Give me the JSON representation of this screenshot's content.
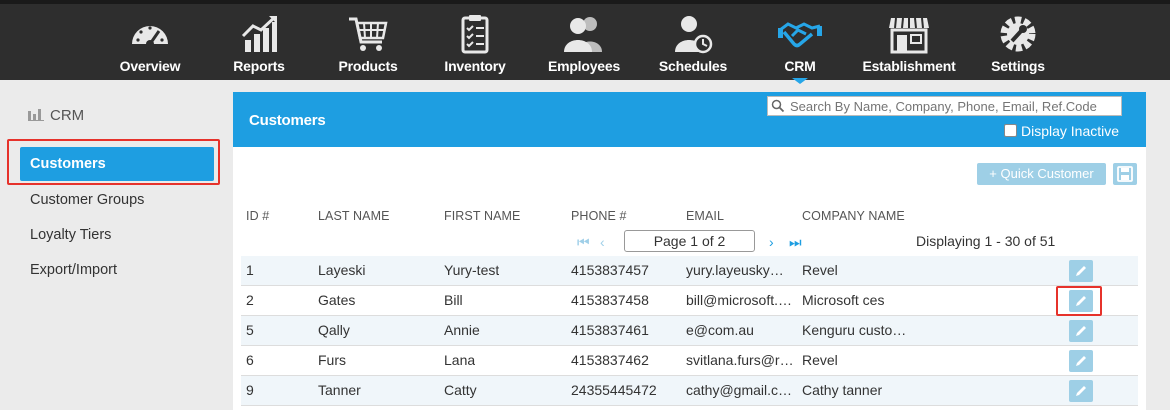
{
  "nav": {
    "items": [
      {
        "label": "Overview",
        "icon": "speedometer-icon"
      },
      {
        "label": "Reports",
        "icon": "bar-chart-icon"
      },
      {
        "label": "Products",
        "icon": "shopping-cart-icon"
      },
      {
        "label": "Inventory",
        "icon": "clipboard-icon"
      },
      {
        "label": "Employees",
        "icon": "people-icon"
      },
      {
        "label": "Schedules",
        "icon": "person-clock-icon"
      },
      {
        "label": "CRM",
        "icon": "handshake-icon"
      },
      {
        "label": "Establishment",
        "icon": "storefront-icon"
      },
      {
        "label": "Settings",
        "icon": "gear-wrench-icon"
      }
    ],
    "active": "CRM"
  },
  "sidebar": {
    "heading": "CRM",
    "items": [
      {
        "label": "Customers"
      },
      {
        "label": "Customer Groups"
      },
      {
        "label": "Loyalty Tiers"
      },
      {
        "label": "Export/Import"
      }
    ]
  },
  "panel": {
    "title": "Customers",
    "search_placeholder": "Search By Name, Company, Phone, Email, Ref.Code",
    "display_inactive": "Display Inactive",
    "quick_customer": "+ Quick Customer"
  },
  "table": {
    "columns": [
      "ID #",
      "LAST NAME",
      "FIRST NAME",
      "PHONE #",
      "EMAIL",
      "COMPANY NAME"
    ],
    "pager": "Page 1 of 2",
    "displaying": "Displaying 1 - 30 of 51",
    "rows": [
      {
        "id": "1",
        "last": "Layeski",
        "first": "Yury-test",
        "phone": "4153837457",
        "email": "yury.layeusky…",
        "company": "Revel"
      },
      {
        "id": "2",
        "last": "Gates",
        "first": "Bill",
        "phone": "4153837458",
        "email": "bill@microsoft.…",
        "company": "Microsoft ces"
      },
      {
        "id": "5",
        "last": "Qally",
        "first": "Annie",
        "phone": "4153837461",
        "email": "e@com.au",
        "company": "Kenguru custo…"
      },
      {
        "id": "6",
        "last": "Furs",
        "first": "Lana",
        "phone": "4153837462",
        "email": "svitlana.furs@r…",
        "company": "Revel"
      },
      {
        "id": "9",
        "last": "Tanner",
        "first": "Catty",
        "phone": "24355445472",
        "email": "cathy@gmail.c…",
        "company": "Cathy tanner"
      }
    ]
  },
  "colors": {
    "accent": "#1e9ee1",
    "highlight": "#e6322b",
    "nav_bg": "#2e2e2e"
  }
}
